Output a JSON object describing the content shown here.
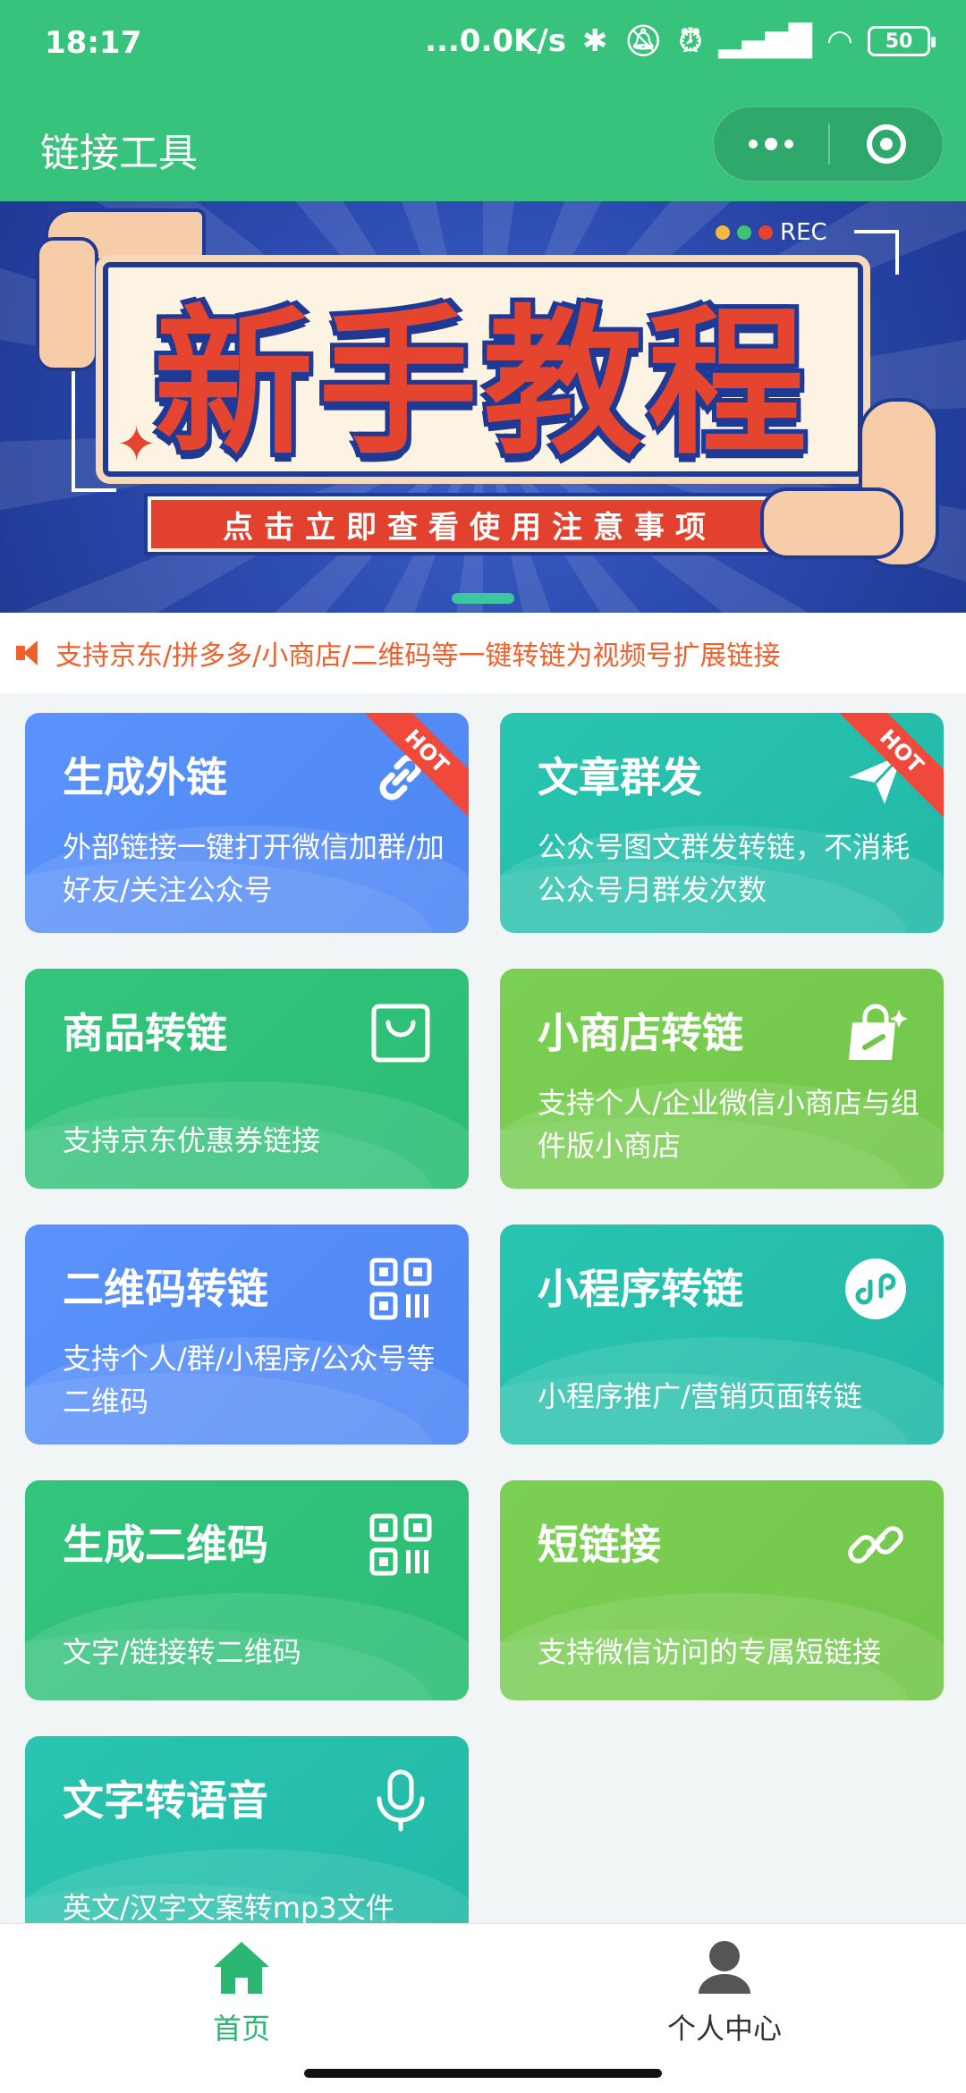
{
  "status_bar": {
    "time": "18:17",
    "network_speed": "...0.0K/s",
    "battery": "50"
  },
  "nav": {
    "title": "链接工具"
  },
  "banner": {
    "title": "新手教程",
    "subtitle": "点击立即查看使用注意事项",
    "rec_label": "REC"
  },
  "notice": {
    "text": "支持京东/拼多多/小商店/二维码等一键转链为视频号扩展链接"
  },
  "tools": [
    {
      "title": "生成外链",
      "desc": "外部链接一键打开微信加群/加好友/关注公众号",
      "badge": "HOT",
      "icon": "link-icon"
    },
    {
      "title": "文章群发",
      "desc": "公众号图文群发转链，不消耗公众号月群发次数",
      "badge": "HOT",
      "icon": "paper-plane-icon"
    },
    {
      "title": "商品转链",
      "desc": "支持京东优惠券链接",
      "icon": "shopping-bag-icon"
    },
    {
      "title": "小商店转链",
      "desc": "支持个人/企业微信小商店与组件版小商店",
      "icon": "shop-bag-icon"
    },
    {
      "title": "二维码转链",
      "desc": "支持个人/群/小程序/公众号等二维码",
      "icon": "qr-code-icon"
    },
    {
      "title": "小程序转链",
      "desc": "小程序推广/营销页面转链",
      "icon": "mini-program-icon"
    },
    {
      "title": "生成二维码",
      "desc": "文字/链接转二维码",
      "icon": "qr-code-icon"
    },
    {
      "title": "短链接",
      "desc": "支持微信访问的专属短链接",
      "icon": "link-icon"
    },
    {
      "title": "文字转语音",
      "desc": "英文/汉字文案转mp3文件",
      "icon": "microphone-icon"
    }
  ],
  "tabbar": {
    "home": "首页",
    "profile": "个人中心"
  },
  "colors": {
    "primary_green": "#37c37b",
    "blue_tile": "#5a93fb",
    "teal_tile": "#29c5b0",
    "green_tile": "#33c57d",
    "lime_tile": "#7bd054",
    "notice_orange": "#f0602c",
    "hot_red": "#f0483a"
  }
}
